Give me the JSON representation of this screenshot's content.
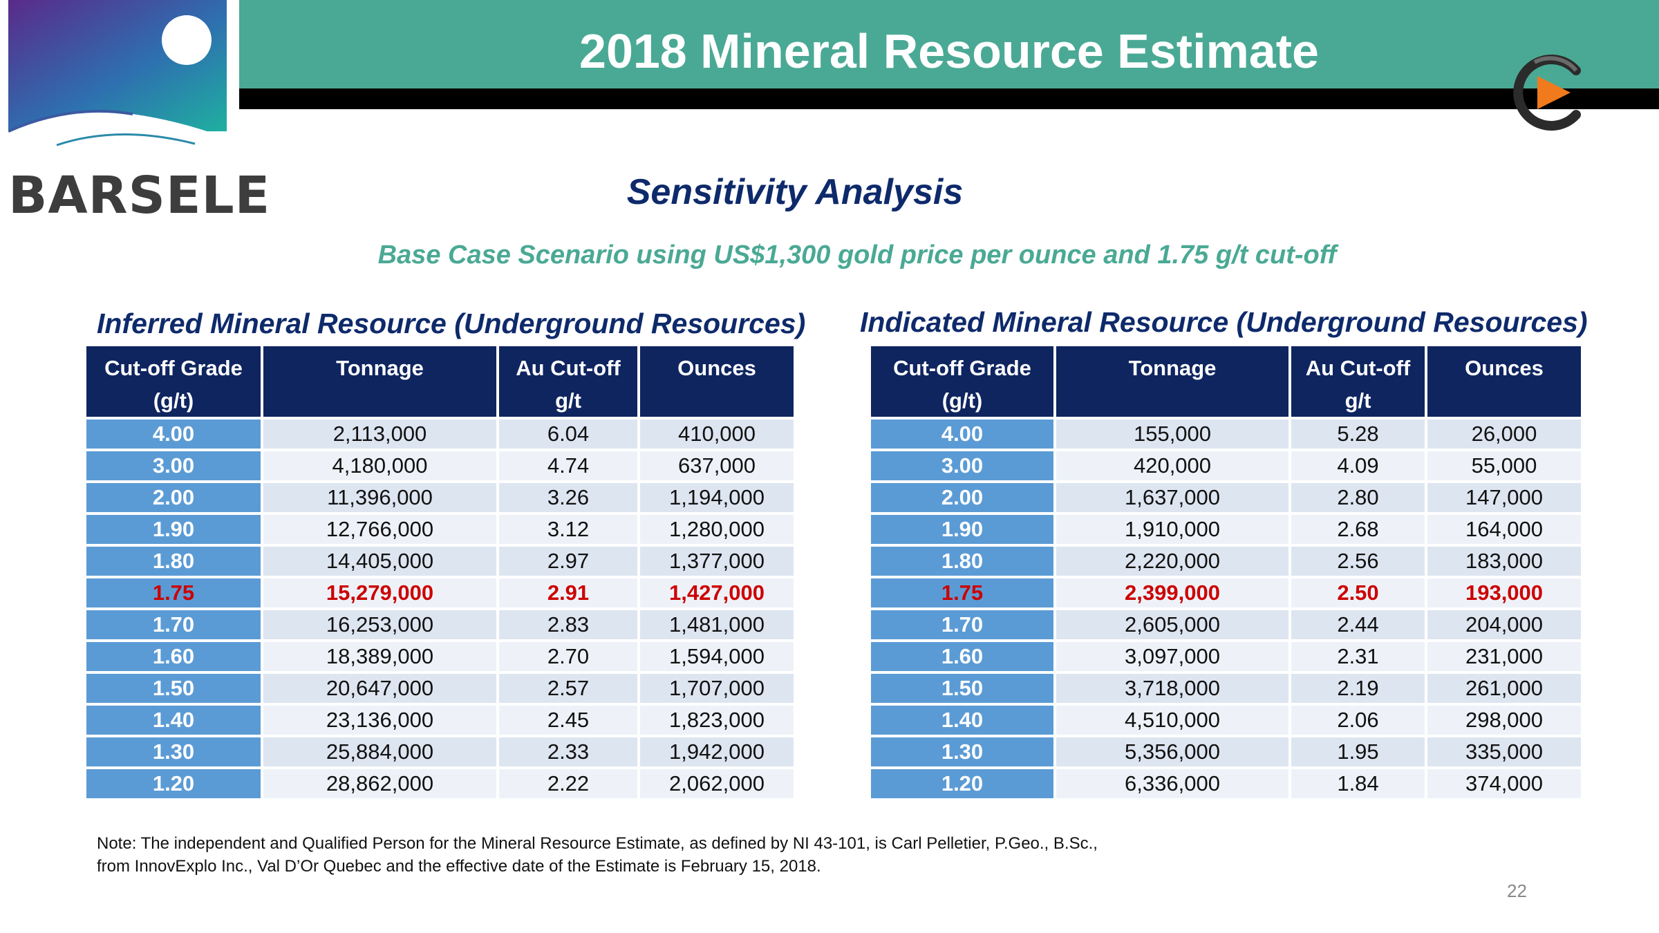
{
  "logo": {
    "text": "BARSELE"
  },
  "header": {
    "title": "2018 Mineral Resource Estimate"
  },
  "subtitle": "Sensitivity Analysis",
  "scenario": "Base Case Scenario using US$1,300 gold price per ounce and 1.75 g/t cut-off",
  "colors": {
    "header_teal": "#4aa994",
    "header_navy": "#0f2560",
    "cutoff_blue": "#5b9bd5",
    "highlight_red": "#cc0000",
    "title_navy": "#0e2a6b"
  },
  "inferred": {
    "title": "Inferred Mineral Resource (Underground Resources)",
    "headers": [
      [
        "Cut-off Grade",
        "(g/t)"
      ],
      [
        "Tonnage",
        ""
      ],
      [
        "Au Cut-off",
        "g/t"
      ],
      [
        "Ounces",
        ""
      ]
    ],
    "rows": [
      [
        "4.00",
        "2,113,000",
        "6.04",
        "410,000"
      ],
      [
        "3.00",
        "4,180,000",
        "4.74",
        "637,000"
      ],
      [
        "2.00",
        "11,396,000",
        "3.26",
        "1,194,000"
      ],
      [
        "1.90",
        "12,766,000",
        "3.12",
        "1,280,000"
      ],
      [
        "1.80",
        "14,405,000",
        "2.97",
        "1,377,000"
      ],
      [
        "1.75",
        "15,279,000",
        "2.91",
        "1,427,000"
      ],
      [
        "1.70",
        "16,253,000",
        "2.83",
        "1,481,000"
      ],
      [
        "1.60",
        "18,389,000",
        "2.70",
        "1,594,000"
      ],
      [
        "1.50",
        "20,647,000",
        "2.57",
        "1,707,000"
      ],
      [
        "1.40",
        "23,136,000",
        "2.45",
        "1,823,000"
      ],
      [
        "1.30",
        "25,884,000",
        "2.33",
        "1,942,000"
      ],
      [
        "1.20",
        "28,862,000",
        "2.22",
        "2,062,000"
      ]
    ],
    "highlight_row": 5
  },
  "indicated": {
    "title": "Indicated Mineral Resource (Underground Resources)",
    "headers": [
      [
        "Cut-off Grade",
        "(g/t)"
      ],
      [
        "Tonnage",
        ""
      ],
      [
        "Au Cut-off",
        "g/t"
      ],
      [
        "Ounces",
        ""
      ]
    ],
    "rows": [
      [
        "4.00",
        "155,000",
        "5.28",
        "26,000"
      ],
      [
        "3.00",
        "420,000",
        "4.09",
        "55,000"
      ],
      [
        "2.00",
        "1,637,000",
        "2.80",
        "147,000"
      ],
      [
        "1.90",
        "1,910,000",
        "2.68",
        "164,000"
      ],
      [
        "1.80",
        "2,220,000",
        "2.56",
        "183,000"
      ],
      [
        "1.75",
        "2,399,000",
        "2.50",
        "193,000"
      ],
      [
        "1.70",
        "2,605,000",
        "2.44",
        "204,000"
      ],
      [
        "1.60",
        "3,097,000",
        "2.31",
        "231,000"
      ],
      [
        "1.50",
        "3,718,000",
        "2.19",
        "261,000"
      ],
      [
        "1.40",
        "4,510,000",
        "2.06",
        "298,000"
      ],
      [
        "1.30",
        "5,356,000",
        "1.95",
        "335,000"
      ],
      [
        "1.20",
        "6,336,000",
        "1.84",
        "374,000"
      ]
    ],
    "highlight_row": 5
  },
  "note": {
    "line1": "Note:  The independent and Qualified Person for the Mineral Resource Estimate, as defined by NI 43-101, is Carl Pelletier, P.Geo., B.Sc.,",
    "line2": "from InnovExplo Inc., Val D’Or Quebec and the effective date of the Estimate is February 15, 2018."
  },
  "page_number": "22"
}
